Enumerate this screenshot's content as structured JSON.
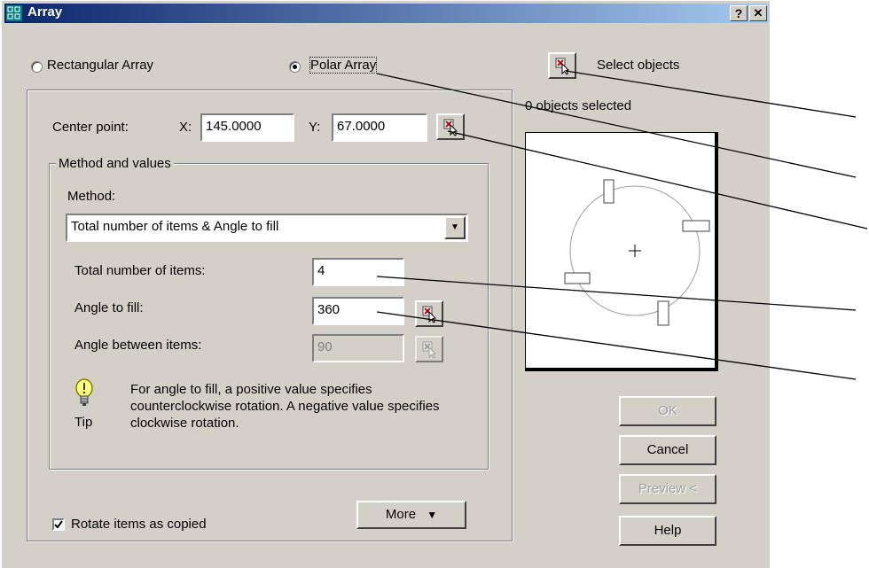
{
  "window": {
    "title": "Array",
    "help_button": "?",
    "close_button": "✕"
  },
  "array_type": {
    "rectangular_label": "Rectangular Array",
    "polar_label": "Polar Array",
    "selected": "polar"
  },
  "select_objects": {
    "label": "Select objects",
    "status": "0 objects selected"
  },
  "center_point": {
    "label": "Center point:",
    "x_label": "X:",
    "x_value": "145.0000",
    "y_label": "Y:",
    "y_value": "67.0000"
  },
  "method_group": {
    "title": "Method and values",
    "method_label": "Method:",
    "method_value": "Total number of items & Angle to fill",
    "total_items_label": "Total number of items:",
    "total_items_value": "4",
    "angle_fill_label": "Angle to fill:",
    "angle_fill_value": "360",
    "angle_between_label": "Angle between items:",
    "angle_between_value": "90"
  },
  "tip": {
    "label": "Tip",
    "text": "For angle to fill, a positive value specifies counterclockwise rotation.  A negative value specifies clockwise rotation."
  },
  "rotate_items": {
    "label": "Rotate items as copied",
    "checked": true
  },
  "buttons": {
    "more": "More",
    "ok": "OK",
    "cancel": "Cancel",
    "preview": "Preview <",
    "help": "Help"
  }
}
